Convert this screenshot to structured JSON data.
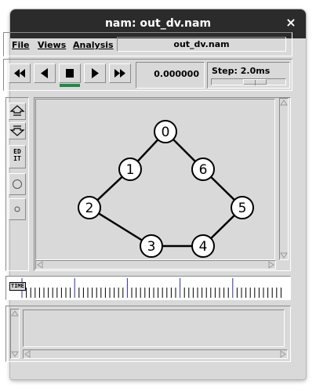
{
  "window": {
    "title": "nam: out_dv.nam",
    "close_glyph": "×"
  },
  "menu": {
    "items": [
      {
        "label": "File"
      },
      {
        "label": "Views"
      },
      {
        "label": "Analysis"
      }
    ],
    "filename": "out_dv.nam"
  },
  "controls": {
    "buttons": [
      {
        "name": "rewind-button",
        "icon": "rewind-icon"
      },
      {
        "name": "play-backward-button",
        "icon": "play-backward-icon"
      },
      {
        "name": "stop-button",
        "icon": "stop-icon"
      },
      {
        "name": "play-forward-button",
        "icon": "play-forward-icon"
      },
      {
        "name": "fast-forward-button",
        "icon": "fast-forward-icon"
      }
    ],
    "time": "0.000000",
    "step_label": "Step: 2.0ms",
    "stop_indicator_color": "#1e8a46"
  },
  "tools": {
    "edit_label_line1": "ED",
    "edit_label_line2": "IT",
    "icons": [
      "zoom-in-icon",
      "zoom-out-icon",
      "edit-icon",
      "node-large-icon",
      "node-small-icon"
    ]
  },
  "graph": {
    "nodes": [
      {
        "id": "0"
      },
      {
        "id": "1"
      },
      {
        "id": "6"
      },
      {
        "id": "2"
      },
      {
        "id": "5"
      },
      {
        "id": "3"
      },
      {
        "id": "4"
      }
    ],
    "links": [
      [
        "0",
        "1"
      ],
      [
        "0",
        "6"
      ],
      [
        "1",
        "2"
      ],
      [
        "6",
        "5"
      ],
      [
        "2",
        "3"
      ],
      [
        "3",
        "4"
      ],
      [
        "4",
        "5"
      ]
    ]
  },
  "timeline": {
    "label": "TIME"
  }
}
